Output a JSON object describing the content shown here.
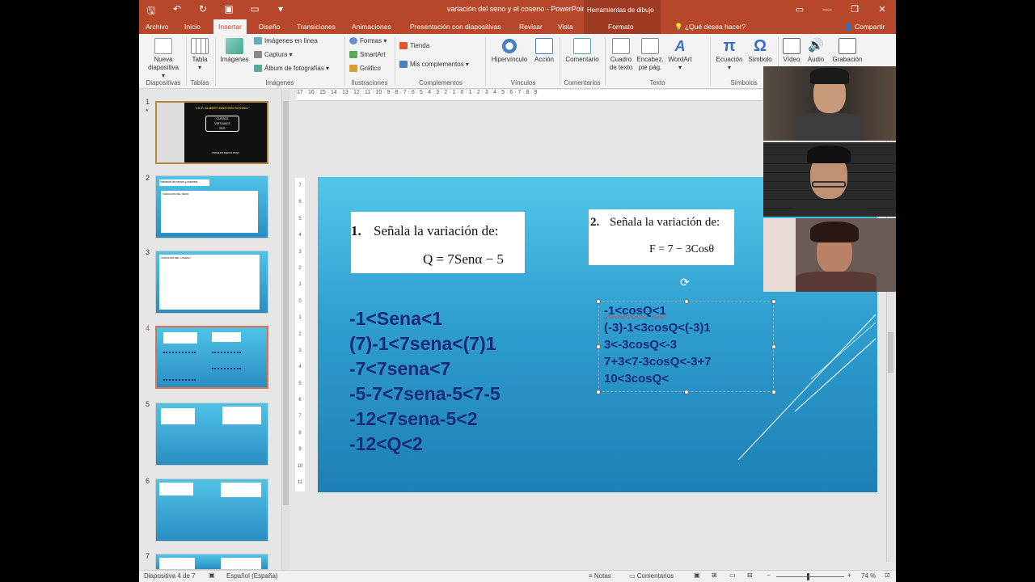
{
  "window": {
    "title": "variación del seno y el coseno - PowerPoint",
    "contextual_tab_group": "Herramientas de dibujo",
    "controls": [
      "restore-down",
      "minimize",
      "maximize",
      "close"
    ]
  },
  "tabs": [
    "Archivo",
    "Inicio",
    "Insertar",
    "Diseño",
    "Transiciones",
    "Animaciones",
    "Presentación con diapositivas",
    "Revisar",
    "Vista",
    "Formato"
  ],
  "active_tab": "Insertar",
  "search_placeholder": "¿Qué desea hacer?",
  "share_label": "Compartir",
  "ribbon": {
    "diapositivas": {
      "label": "Diapositivas",
      "nueva": "Nueva",
      "nueva2": "diapositiva ▾"
    },
    "tablas": {
      "label": "Tablas",
      "tabla": "Tabla",
      "tabla_arrow": "▾"
    },
    "imagenes": {
      "label": "Imágenes",
      "imagenes": "Imágenes",
      "en_linea": "Imágenes en línea",
      "captura": "Captura ▾",
      "album": "Álbum de fotografías ▾"
    },
    "ilustraciones": {
      "label": "Ilustraciones",
      "formas": "Formas ▾",
      "smartart": "SmartArt",
      "grafico": "Gráfico"
    },
    "complementos": {
      "label": "Complementos",
      "tienda": "Tienda",
      "mis": "Mis complementos ▾"
    },
    "vinculos": {
      "label": "Vínculos",
      "hipervinculo": "Hipervínculo",
      "accion": "Acción"
    },
    "comentarios": {
      "label": "Comentarios",
      "comentario": "Comentario"
    },
    "texto": {
      "label": "Texto",
      "cuadro1": "Cuadro",
      "cuadro2": "de texto",
      "encab1": "Encabez.",
      "encab2": "pie pág.",
      "wordart": "WordArt",
      "wordart_arrow": "▾"
    },
    "simbolos": {
      "label": "Símbolos",
      "ecuacion": "Ecuación",
      "ecuacion_arrow": "▾",
      "simbolo": "Símbolo"
    },
    "multimedia": {
      "video": "Vídeo",
      "audio": "Audio",
      "grabacion": "Grabación"
    }
  },
  "ruler_h": "17 · 16 · 15 · 14 · 13 · 12 · 11 · 10 · 9 · 8 · 7 · 6 · 5 · 4 · 3 · 2 · 1 · 0 · 1 · 2 · 3 · 4 · 5 · 6 · 7 · 8 · 9",
  "ruler_v": [
    "7",
    "6",
    "5",
    "4",
    "3",
    "2",
    "1",
    "0",
    "1",
    "2",
    "3",
    "4",
    "5",
    "6",
    "7",
    "8",
    "9",
    "10",
    "11"
  ],
  "thumbnails": [
    {
      "num": "1",
      "star": "*"
    },
    {
      "num": "2"
    },
    {
      "num": "3"
    },
    {
      "num": "4",
      "selected": true
    },
    {
      "num": "5"
    },
    {
      "num": "6"
    },
    {
      "num": "7"
    }
  ],
  "thumb_text": {
    "t1_school": "\"I.E.P. ALBERT EINSTEIN SCHOOL\"",
    "t1_c1": "CURSOS",
    "t1_c2": "VIRTUALES",
    "t1_c3": "2021",
    "t1_foot": "PRIMERO MEDIO PASO",
    "t2_title": "Variación de senos y cosenos",
    "t2_sub": "VARIACIÓN DEL SENO",
    "t3_sub": "VARIACIÓN DEL COSENO"
  },
  "slide": {
    "q1": {
      "num": "1.",
      "text": "Señala la variación de:",
      "formula": "Q = 7Senα − 5"
    },
    "q2": {
      "num": "2.",
      "text": "Señala la variación de:",
      "formula": "F = 7 − 3Cosθ"
    },
    "work1": [
      "-1<Sena<1",
      "(7)-1<7sena<(7)1",
      "-7<7sena<7",
      "-5-7<7sena-5<7-5",
      "-12<7sena-5<2",
      "-12<Q<2"
    ],
    "work2": [
      "-1<cosQ<1",
      "(-3)-1<3cosQ<(-3)1",
      "3<-3cosQ<-3",
      "7+3<7-3cosQ<-3+7",
      "10<3cosQ<"
    ]
  },
  "status": {
    "slide_info": "Diapositiva 4 de 7",
    "language": "Español (España)",
    "notes": "Notas",
    "comments": "Comentarios",
    "zoom": "74 %"
  },
  "colors": {
    "accent": "#b7472a",
    "slide_top": "#53c7e8",
    "slide_bottom": "#1e7fb5",
    "math_text": "#1b2a78"
  }
}
